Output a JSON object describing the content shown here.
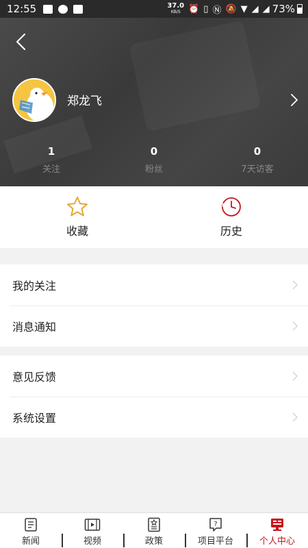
{
  "status_bar": {
    "time": "12:55",
    "net_speed": "37.0",
    "net_unit": "KB/S",
    "battery": "73%"
  },
  "profile": {
    "username": "郑龙飞",
    "stats": [
      {
        "value": "1",
        "label": "关注"
      },
      {
        "value": "0",
        "label": "粉丝"
      },
      {
        "value": "0",
        "label": "7天访客"
      }
    ]
  },
  "quick_actions": [
    {
      "label": "收藏",
      "icon": "star-icon",
      "color": "#e0a93a"
    },
    {
      "label": "历史",
      "icon": "history-clock-icon",
      "color": "#c8161d"
    }
  ],
  "menu_groups": [
    [
      {
        "label": "我的关注"
      },
      {
        "label": "消息通知"
      }
    ],
    [
      {
        "label": "意见反馈"
      },
      {
        "label": "系统设置"
      }
    ]
  ],
  "tabs": [
    {
      "label": "新闻",
      "icon": "news-icon",
      "active": false
    },
    {
      "label": "视频",
      "icon": "video-icon",
      "active": false
    },
    {
      "label": "政策",
      "icon": "policy-icon",
      "active": false
    },
    {
      "label": "项目平台",
      "icon": "project-icon",
      "active": false
    },
    {
      "label": "个人中心",
      "icon": "profile-center-icon",
      "active": true
    }
  ],
  "colors": {
    "accent": "#c8161d",
    "star": "#e0a93a",
    "header_bg": "#3f3f3f"
  }
}
